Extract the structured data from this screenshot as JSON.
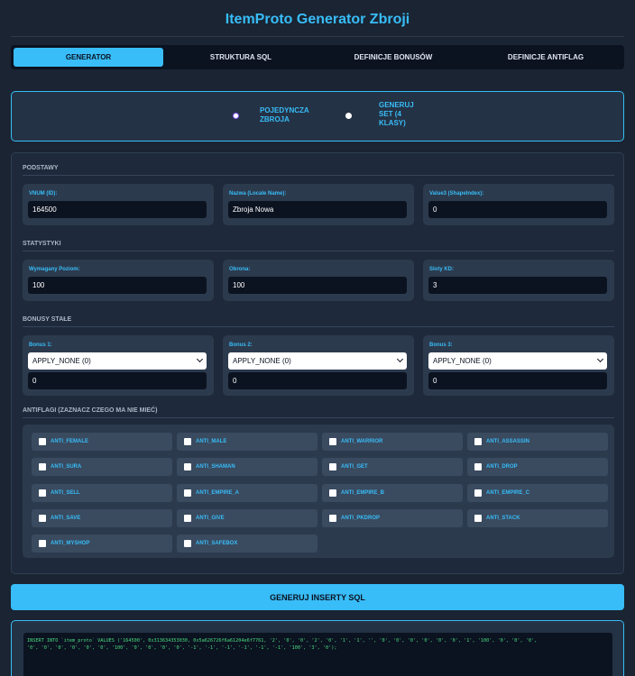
{
  "app": {
    "title": "ItemProto Generator Zbroji"
  },
  "tabs": [
    {
      "label": "GENERATOR",
      "active": true
    },
    {
      "label": "STRUKTURA SQL",
      "active": false
    },
    {
      "label": "DEFINICJE BONUSÓW",
      "active": false
    },
    {
      "label": "DEFINICJE ANTIFLAG",
      "active": false
    }
  ],
  "mode": {
    "single_label": "POJEDYNCZA\nZBROJA",
    "set_label": "GENERUJ\nSET (4\nKLASY)",
    "selected": "single"
  },
  "sections": {
    "podstawy": "PODSTAWY",
    "statystyki": "STATYSTYKI",
    "bonusy": "BONUSY STAŁE",
    "antiflagi": "ANTIFLAGI (ZAZNACZ CZEGO MA NIE MIEĆ)"
  },
  "podstawy": {
    "vnum_label": "VNUM (ID):",
    "vnum_value": "164500",
    "name_label": "Nazwa (Locale Name):",
    "name_value": "Zbroja Nowa",
    "value3_label": "Value3 (ShapeIndex):",
    "value3_value": "0"
  },
  "statystyki": {
    "level_label": "Wymagany Poziom:",
    "level_value": "100",
    "def_label": "Obrona:",
    "def_value": "100",
    "slots_label": "Sloty KD:",
    "slots_value": "3"
  },
  "bonusy": {
    "b1_label": "Bonus 1:",
    "b1_select": "APPLY_NONE (0)",
    "b1_value": "0",
    "b2_label": "Bonus 2:",
    "b2_select": "APPLY_NONE (0)",
    "b2_value": "0",
    "b3_label": "Bonus 3:",
    "b3_select": "APPLY_NONE (0)",
    "b3_value": "0"
  },
  "antiflags": [
    "ANTI_FEMALE",
    "ANTI_MALE",
    "ANTI_WARRIOR",
    "ANTI_ASSASSIN",
    "ANTI_SURA",
    "ANTI_SHAMAN",
    "ANTI_GET",
    "ANTI_DROP",
    "ANTI_SELL",
    "ANTI_EMPIRE_A",
    "ANTI_EMPIRE_B",
    "ANTI_EMPIRE_C",
    "ANTI_SAVE",
    "ANTI_GIVE",
    "ANTI_PKDROP",
    "ANTI_STACK",
    "ANTI_MYSHOP",
    "ANTI_SAFEBOX"
  ],
  "generate_button": "GENERUJ INSERTY SQL",
  "output": {
    "sql": "INSERT INTO `item_proto` VALUES ('164500', 0x313634353030, 0x5a626726f6a61204e6f7761, '2', '0', '0', '2', '0', '1', '1', '', '0', '0', '0', '0', '0', '0', '1', '100', '0', '0', '0',\n'0', '0', '0', '0', '0', '0', '100', '0', '0', '0', '0', '-1', '-1', '-1', '-1', '-1', '-1', '100', '3', '0');"
  },
  "colors": {
    "accent": "#38bdf8",
    "background": "#1a2432",
    "panel": "#1e293b",
    "card": "#2c3a4d",
    "sql_text": "#4ade80"
  }
}
